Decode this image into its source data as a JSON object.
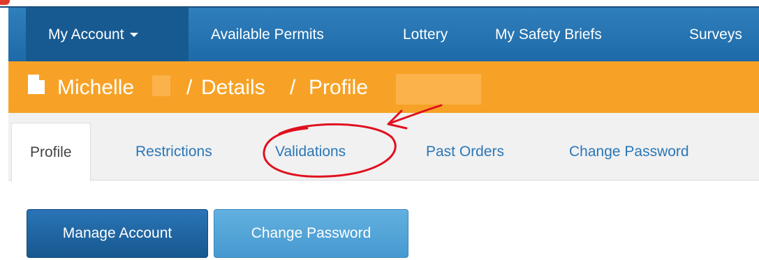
{
  "navbar": {
    "items": [
      {
        "label": "My Account"
      },
      {
        "label": "Available Permits"
      },
      {
        "label": "Lottery"
      },
      {
        "label": "My Safety Briefs"
      },
      {
        "label": "Surveys"
      }
    ]
  },
  "breadcrumb": {
    "name": "Michelle",
    "separator": "/",
    "details": "Details",
    "profile": "Profile"
  },
  "tabs": [
    {
      "label": "Profile"
    },
    {
      "label": "Restrictions"
    },
    {
      "label": "Validations"
    },
    {
      "label": "Past Orders"
    },
    {
      "label": "Change Password"
    }
  ],
  "buttons": {
    "manage_account": "Manage Account",
    "change_password": "Change Password"
  },
  "colors": {
    "navbar": "#1e6aa8",
    "breadcrumb_bar": "#f7a226",
    "annotation": "#e0101f"
  },
  "icons": {
    "breadcrumb_icon": "document-icon",
    "dropdown": "caret-down-icon"
  }
}
